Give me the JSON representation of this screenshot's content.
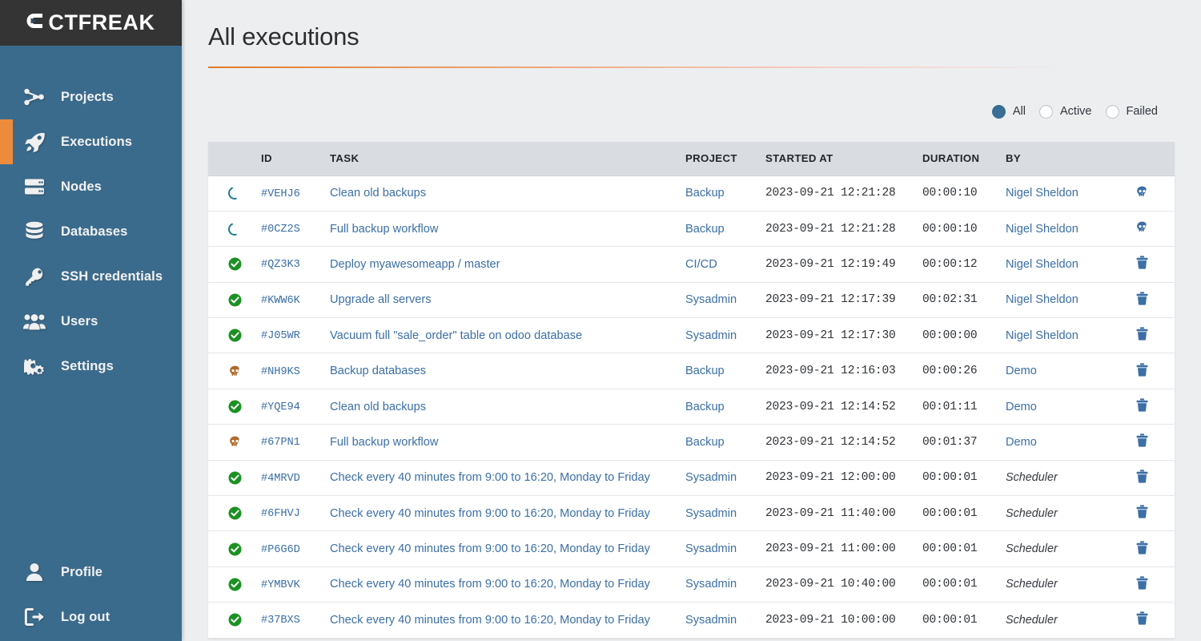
{
  "brand": {
    "name": "CTFREAK",
    "logo_icon": "ctfreak-logo"
  },
  "sidebar": {
    "items": [
      {
        "label": "Projects",
        "icon": "sitemap-icon",
        "active": false
      },
      {
        "label": "Executions",
        "icon": "rocket-icon",
        "active": true
      },
      {
        "label": "Nodes",
        "icon": "server-icon",
        "active": false
      },
      {
        "label": "Databases",
        "icon": "database-icon",
        "active": false
      },
      {
        "label": "SSH credentials",
        "icon": "key-icon",
        "active": false
      },
      {
        "label": "Users",
        "icon": "users-icon",
        "active": false
      },
      {
        "label": "Settings",
        "icon": "gears-icon",
        "active": false
      }
    ],
    "bottom_items": [
      {
        "label": "Profile",
        "icon": "user-icon"
      },
      {
        "label": "Log out",
        "icon": "logout-icon"
      }
    ],
    "accent_color": "#ec8b3c",
    "background_color": "#3b6b8c"
  },
  "header": {
    "title": "All executions"
  },
  "filters": {
    "options": [
      {
        "label": "All",
        "selected": true
      },
      {
        "label": "Active",
        "selected": false
      },
      {
        "label": "Failed",
        "selected": false
      }
    ]
  },
  "table": {
    "columns": [
      "",
      "ID",
      "TASK",
      "PROJECT",
      "STARTED AT",
      "DURATION",
      "BY",
      ""
    ],
    "rows": [
      {
        "status": "running",
        "id": "#VEHJ6",
        "task": "Clean old backups",
        "project": "Backup",
        "started_at": "2023-09-21 12:21:28",
        "duration": "00:00:10",
        "by": "Nigel Sheldon",
        "by_link": true,
        "action": "kill-icon"
      },
      {
        "status": "running",
        "id": "#0CZ2S",
        "task": "Full backup workflow",
        "project": "Backup",
        "started_at": "2023-09-21 12:21:28",
        "duration": "00:00:10",
        "by": "Nigel Sheldon",
        "by_link": true,
        "action": "kill-icon"
      },
      {
        "status": "success",
        "id": "#QZ3K3",
        "task": "Deploy myawesomeapp / master",
        "project": "CI/CD",
        "started_at": "2023-09-21 12:19:49",
        "duration": "00:00:12",
        "by": "Nigel Sheldon",
        "by_link": true,
        "action": "trash-icon"
      },
      {
        "status": "success",
        "id": "#KWW6K",
        "task": "Upgrade all servers",
        "project": "Sysadmin",
        "started_at": "2023-09-21 12:17:39",
        "duration": "00:02:31",
        "by": "Nigel Sheldon",
        "by_link": true,
        "action": "trash-icon"
      },
      {
        "status": "success",
        "id": "#J05WR",
        "task": "Vacuum full \"sale_order\" table on odoo database",
        "project": "Sysadmin",
        "started_at": "2023-09-21 12:17:30",
        "duration": "00:00:00",
        "by": "Nigel Sheldon",
        "by_link": true,
        "action": "trash-icon"
      },
      {
        "status": "failed",
        "id": "#NH9KS",
        "task": "Backup databases",
        "project": "Backup",
        "started_at": "2023-09-21 12:16:03",
        "duration": "00:00:26",
        "by": "Demo",
        "by_link": true,
        "action": "trash-icon"
      },
      {
        "status": "success",
        "id": "#YQE94",
        "task": "Clean old backups",
        "project": "Backup",
        "started_at": "2023-09-21 12:14:52",
        "duration": "00:01:11",
        "by": "Demo",
        "by_link": true,
        "action": "trash-icon"
      },
      {
        "status": "failed",
        "id": "#67PN1",
        "task": "Full backup workflow",
        "project": "Backup",
        "started_at": "2023-09-21 12:14:52",
        "duration": "00:01:37",
        "by": "Demo",
        "by_link": true,
        "action": "trash-icon"
      },
      {
        "status": "success",
        "id": "#4MRVD",
        "task": "Check every 40 minutes from 9:00 to 16:20, Monday to Friday",
        "project": "Sysadmin",
        "started_at": "2023-09-21 12:00:00",
        "duration": "00:00:01",
        "by": "Scheduler",
        "by_link": false,
        "action": "trash-icon"
      },
      {
        "status": "success",
        "id": "#6FHVJ",
        "task": "Check every 40 minutes from 9:00 to 16:20, Monday to Friday",
        "project": "Sysadmin",
        "started_at": "2023-09-21 11:40:00",
        "duration": "00:00:01",
        "by": "Scheduler",
        "by_link": false,
        "action": "trash-icon"
      },
      {
        "status": "success",
        "id": "#P6G6D",
        "task": "Check every 40 minutes from 9:00 to 16:20, Monday to Friday",
        "project": "Sysadmin",
        "started_at": "2023-09-21 11:00:00",
        "duration": "00:00:01",
        "by": "Scheduler",
        "by_link": false,
        "action": "trash-icon"
      },
      {
        "status": "success",
        "id": "#YMBVK",
        "task": "Check every 40 minutes from 9:00 to 16:20, Monday to Friday",
        "project": "Sysadmin",
        "started_at": "2023-09-21 10:40:00",
        "duration": "00:00:01",
        "by": "Scheduler",
        "by_link": false,
        "action": "trash-icon"
      },
      {
        "status": "success",
        "id": "#37BXS",
        "task": "Check every 40 minutes from 9:00 to 16:20, Monday to Friday",
        "project": "Sysadmin",
        "started_at": "2023-09-21 10:00:00",
        "duration": "00:00:01",
        "by": "Scheduler",
        "by_link": false,
        "action": "trash-icon"
      }
    ]
  },
  "colors": {
    "accent": "#ec8b3c",
    "sidebar": "#3b6b8c",
    "link": "#3b6fa5",
    "success": "#1c9123",
    "failed": "#b06a27",
    "running": "#1b7f8e",
    "header_row": "#d9dce1"
  }
}
